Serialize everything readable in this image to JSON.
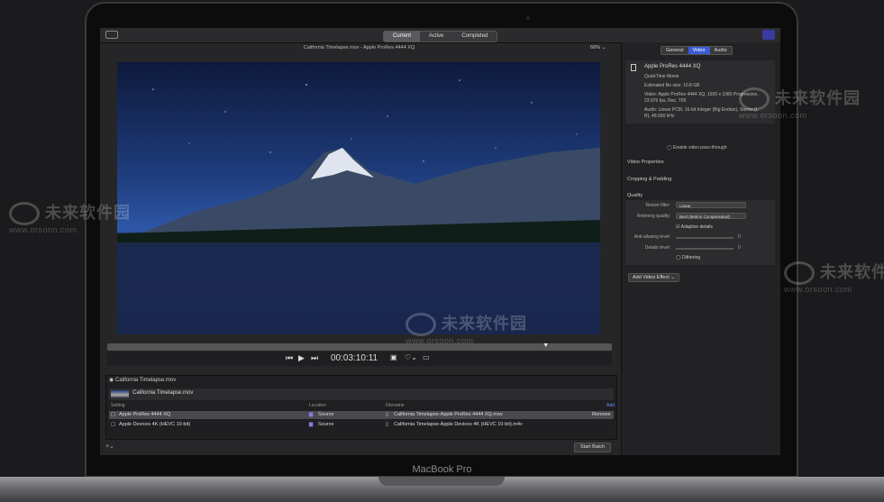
{
  "device": {
    "model": "MacBook Pro"
  },
  "watermark": {
    "text": "未来软件园",
    "url": "www.orsoon.com"
  },
  "topbar": {
    "tabs": [
      {
        "label": "Current",
        "active": true
      },
      {
        "label": "Active",
        "active": false
      },
      {
        "label": "Completed",
        "active": false
      }
    ]
  },
  "viewer": {
    "title": "California Timelapse.mov - Apple ProRes 4444 XQ",
    "zoom": "60%",
    "timecode": "00:03:10:11",
    "playhead": 0.87
  },
  "batch": {
    "header": "California Timelapse.mov",
    "job_title": "California Timelapse.mov",
    "columns": {
      "setting": "Setting",
      "location": "Location",
      "filename": "Filename"
    },
    "add_label": "Add",
    "rows": [
      {
        "setting": "Apple ProRes 4444 XQ",
        "location": "Source",
        "filename": "California Timelapse-Apple ProRes 4444 XQ.mov",
        "action": "Remove",
        "selected": true
      },
      {
        "setting": "Apple Devices 4K (HEVC 10-bit)",
        "location": "Source",
        "filename": "California Timelapse-Apple Devices 4K (HEVC 10-bit).m4v",
        "action": "",
        "selected": false
      }
    ],
    "start_label": "Start Batch"
  },
  "inspector": {
    "tabs": [
      {
        "label": "General",
        "active": false
      },
      {
        "label": "Video",
        "active": true
      },
      {
        "label": "Audio",
        "active": false
      }
    ],
    "summary": {
      "title": "Apple ProRes 4444 XQ",
      "format": "QuickTime Movie",
      "size": "Estimated file size: 10.8 GB",
      "video_1": "Video: Apple ProRes 4444 XQ, 1920 x 1080 Progressive,",
      "video_2": "23.976 fps, Rec. 709",
      "audio_1": "Audio: Linear PCM, 16-bit Integer (Big Endian), Stereo (L",
      "audio_2": "R), 48.000 kHz"
    },
    "pass_through": "Enable video pass-through",
    "sections": {
      "video_properties": "Video Properties",
      "cropping": "Cropping & Padding",
      "quality": "Quality"
    },
    "quality": {
      "resize_label": "Resize filter:",
      "resize_value": "Linear",
      "retiming_label": "Retiming quality:",
      "retiming_value": "Best (Motion Compensated)",
      "adaptive": "Adaptive details",
      "antialias_label": "Anti-aliasing level:",
      "antialias_value": "0",
      "details_label": "Details level:",
      "details_value": "0",
      "dithering": "Dithering"
    },
    "add_effect": "Add Video Effect"
  }
}
